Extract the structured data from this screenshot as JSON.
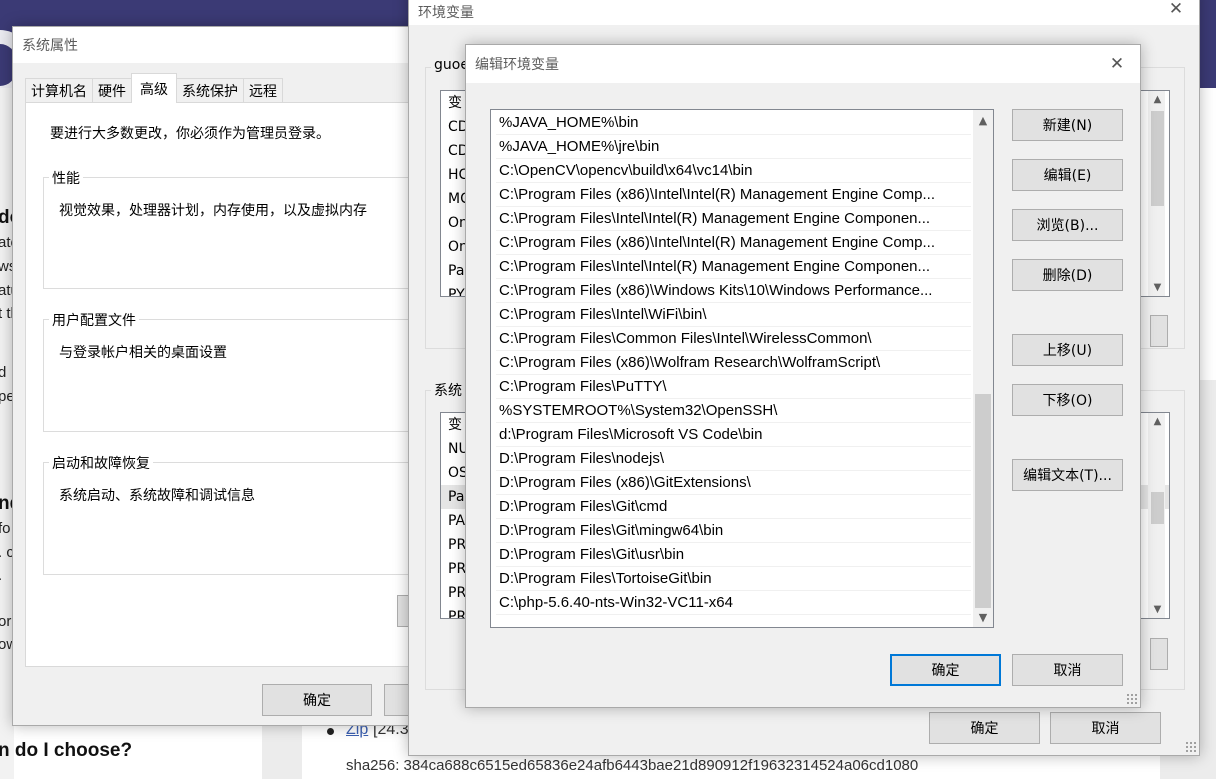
{
  "background": {
    "fragments_left": [
      "do",
      "ate",
      "ws",
      "atu",
      "t th",
      "d",
      "pe",
      "nd",
      "fo",
      ". c",
      ".",
      "or",
      "ow"
    ],
    "bottom_heading": "n do I choose?",
    "zip_link": "Zip",
    "zip_size": "[24.3",
    "sha": "sha256: 384ca688c6515ed65836e24afb6443bae21d890912f19632314524a06cd1080"
  },
  "system_properties": {
    "title": "系统属性",
    "tabs": [
      "计算机名",
      "硬件",
      "高级",
      "系统保护",
      "远程"
    ],
    "active_tab": "高级",
    "admin_notice": "要进行大多数更改，你必须作为管理员登录。",
    "groups": [
      {
        "title": "性能",
        "desc": "视觉效果，处理器计划，内存使用，以及虚拟内存"
      },
      {
        "title": "用户配置文件",
        "desc": "与登录帐户相关的桌面设置"
      },
      {
        "title": "启动和故障恢复",
        "desc": "系统启动、系统故障和调试信息"
      }
    ],
    "ok_label": "确定"
  },
  "env_vars": {
    "title": "环境变量",
    "user_group_label": "guoe",
    "user_vars": [
      "变",
      "CD",
      "CD",
      "HC",
      "MC",
      "On",
      "On",
      "Pa",
      "PY"
    ],
    "system_group_label": "系统",
    "system_vars": [
      "变",
      "NU",
      "OS",
      "Pa",
      "PA",
      "PR",
      "PR",
      "PR",
      "PR"
    ],
    "ok_label": "确定",
    "cancel_label": "取消"
  },
  "edit_env": {
    "title": "编辑环境变量",
    "paths": [
      "%JAVA_HOME%\\bin",
      "%JAVA_HOME%\\jre\\bin",
      "C:\\OpenCV\\opencv\\build\\x64\\vc14\\bin",
      "C:\\Program Files (x86)\\Intel\\Intel(R) Management Engine Comp...",
      "C:\\Program Files\\Intel\\Intel(R) Management Engine Componen...",
      "C:\\Program Files (x86)\\Intel\\Intel(R) Management Engine Comp...",
      "C:\\Program Files\\Intel\\Intel(R) Management Engine Componen...",
      "C:\\Program Files (x86)\\Windows Kits\\10\\Windows Performance...",
      "C:\\Program Files\\Intel\\WiFi\\bin\\",
      "C:\\Program Files\\Common Files\\Intel\\WirelessCommon\\",
      "C:\\Program Files (x86)\\Wolfram Research\\WolframScript\\",
      "C:\\Program Files\\PuTTY\\",
      "%SYSTEMROOT%\\System32\\OpenSSH\\",
      "d:\\Program Files\\Microsoft VS Code\\bin",
      "D:\\Program Files\\nodejs\\",
      "D:\\Program Files (x86)\\GitExtensions\\",
      "D:\\Program Files\\Git\\cmd",
      "D:\\Program Files\\Git\\mingw64\\bin",
      "D:\\Program Files\\Git\\usr\\bin",
      "D:\\Program Files\\TortoiseGit\\bin",
      "C:\\php-5.6.40-nts-Win32-VC11-x64"
    ],
    "buttons": {
      "new": "新建(N)",
      "edit": "编辑(E)",
      "browse": "浏览(B)...",
      "delete": "删除(D)",
      "move_up": "上移(U)",
      "move_down": "下移(O)",
      "edit_text": "编辑文本(T)..."
    },
    "ok_label": "确定",
    "cancel_label": "取消"
  }
}
